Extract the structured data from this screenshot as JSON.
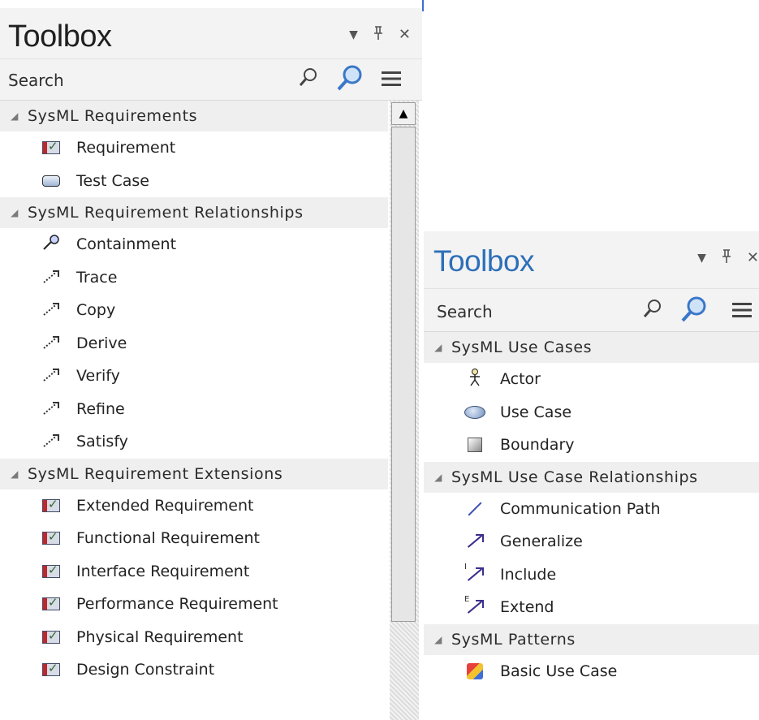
{
  "left": {
    "title": "Toolbox",
    "search_placeholder": "Search",
    "sections": [
      {
        "label": "SysML Requirements",
        "items": [
          {
            "label": "Requirement",
            "icon": "requirement-icon"
          },
          {
            "label": "Test Case",
            "icon": "test-case-icon"
          }
        ]
      },
      {
        "label": "SysML Requirement Relationships",
        "items": [
          {
            "label": "Containment",
            "icon": "containment-icon"
          },
          {
            "label": "Trace",
            "icon": "dependency-arrow-icon"
          },
          {
            "label": "Copy",
            "icon": "dependency-arrow-icon"
          },
          {
            "label": "Derive",
            "icon": "dependency-arrow-icon"
          },
          {
            "label": "Verify",
            "icon": "dependency-arrow-icon"
          },
          {
            "label": "Refine",
            "icon": "dependency-arrow-icon"
          },
          {
            "label": "Satisfy",
            "icon": "dependency-arrow-icon"
          }
        ]
      },
      {
        "label": "SysML Requirement Extensions",
        "items": [
          {
            "label": "Extended Requirement",
            "icon": "requirement-icon"
          },
          {
            "label": "Functional Requirement",
            "icon": "requirement-icon"
          },
          {
            "label": "Interface Requirement",
            "icon": "requirement-icon"
          },
          {
            "label": "Performance Requirement",
            "icon": "requirement-icon"
          },
          {
            "label": "Physical Requirement",
            "icon": "requirement-icon"
          },
          {
            "label": "Design Constraint",
            "icon": "requirement-icon"
          }
        ]
      }
    ]
  },
  "right": {
    "title": "Toolbox",
    "search_placeholder": "Search",
    "sections": [
      {
        "label": "SysML Use Cases",
        "items": [
          {
            "label": "Actor",
            "icon": "actor-icon"
          },
          {
            "label": "Use Case",
            "icon": "use-case-icon"
          },
          {
            "label": "Boundary",
            "icon": "boundary-icon"
          }
        ]
      },
      {
        "label": "SysML Use Case Relationships",
        "items": [
          {
            "label": "Communication Path",
            "icon": "communication-path-icon"
          },
          {
            "label": "Generalize",
            "icon": "generalize-icon"
          },
          {
            "label": "Include",
            "icon": "include-icon"
          },
          {
            "label": "Extend",
            "icon": "extend-icon"
          }
        ]
      },
      {
        "label": "SysML Patterns",
        "items": [
          {
            "label": "Basic Use Case",
            "icon": "pattern-icon"
          }
        ]
      }
    ]
  },
  "icons": {
    "collapse": "▼",
    "pin": "ᛖ",
    "close": "✕",
    "section_expanded": "◢",
    "scroll_up": "▲",
    "include_tag": "I",
    "extend_tag": "E"
  }
}
